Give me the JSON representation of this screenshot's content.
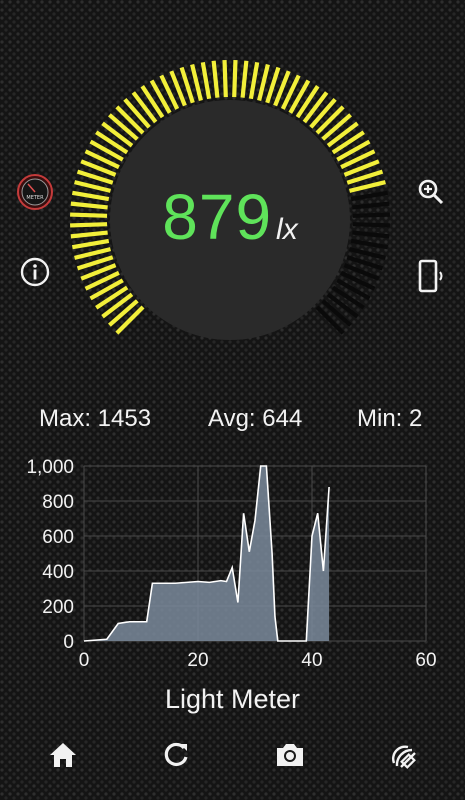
{
  "reading": {
    "value": "879",
    "unit": "lx",
    "fraction": 0.78
  },
  "gauge": {
    "segments": 70,
    "active_color": "#f2ef3a",
    "inactive_color": "#0a0a0a"
  },
  "colors": {
    "reading": "#5fe35a",
    "fill": "#7a8a9b",
    "line": "#ffffff"
  },
  "side_icons": {
    "meter_badge_text": "METER",
    "left": [
      "meter-mode-icon",
      "info-icon"
    ],
    "right": [
      "zoom-in-icon",
      "phone-vibrate-icon"
    ]
  },
  "stats": {
    "max": "Max: 1453",
    "avg": "Avg: 644",
    "min": "Min: 2"
  },
  "chart_data": {
    "type": "area",
    "xlim": [
      0,
      60
    ],
    "ylim": [
      0,
      1000
    ],
    "xticks": [
      "0",
      "20",
      "40",
      "60"
    ],
    "yticks": [
      "0",
      "200",
      "400",
      "600",
      "800",
      "1,000"
    ],
    "x": [
      0,
      4,
      6,
      8,
      10,
      11,
      12,
      14,
      16,
      18,
      20,
      22,
      24,
      25,
      26,
      27,
      28,
      29,
      30,
      31,
      32,
      33,
      33.5,
      34,
      35,
      36,
      37,
      38,
      39,
      40,
      41,
      42,
      43
    ],
    "y": [
      0,
      10,
      100,
      110,
      110,
      110,
      330,
      330,
      330,
      335,
      340,
      335,
      345,
      340,
      420,
      220,
      730,
      510,
      690,
      1000,
      1000,
      500,
      140,
      0,
      0,
      0,
      0,
      0,
      0,
      600,
      730,
      400,
      880
    ],
    "grid": true
  },
  "footer": {
    "title": "Light Meter"
  },
  "nav": [
    "home-icon",
    "refresh-icon",
    "camera-icon",
    "sensor-icon"
  ]
}
